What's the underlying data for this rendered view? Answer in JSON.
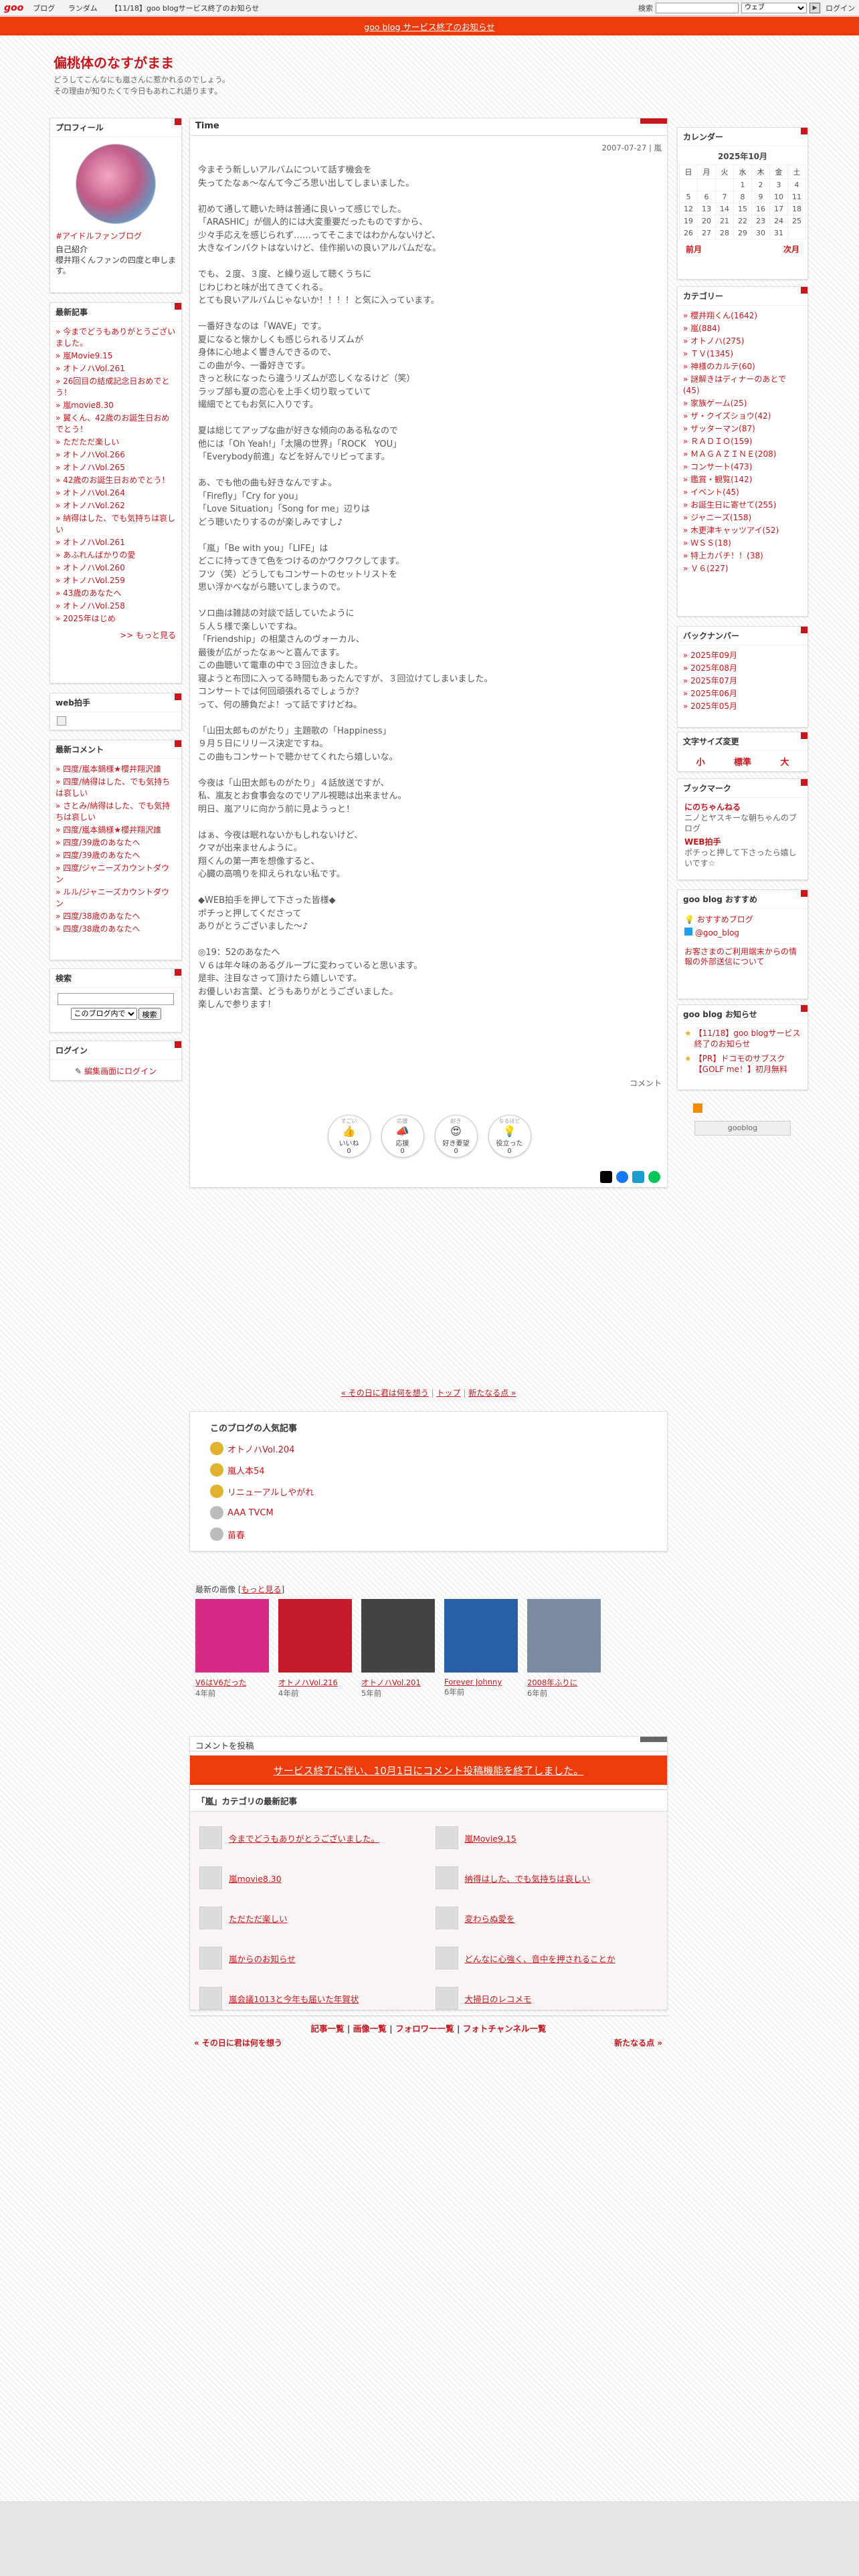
{
  "topbar": {
    "logo": "goo",
    "nav": [
      "ブログ",
      "ランダム",
      "【11/18】goo blogサービス終了のお知らせ"
    ],
    "search_label": "検索",
    "search_select": "ウェブ",
    "login": "ログイン"
  },
  "notice": "goo blog サービス終了のお知らせ",
  "header": {
    "title": "偏桃体のなすがまま",
    "desc1": "どうしてこんなにも嵐さんに惹かれるのでしょう。",
    "desc2": "その理由が知りたくて今日もあれこれ語ります。"
  },
  "profile": {
    "head": "プロフィール",
    "tag": "#アイドルファンブログ",
    "intro_head": "自己紹介",
    "intro": "櫻井翔くんファンの四度と申します。"
  },
  "recent": {
    "head": "最新記事",
    "items": [
      "今までどうもありがとうございました。",
      "嵐Movie9.15",
      "オトノハVol.261",
      "26回目の結成記念日おめでとう！",
      "嵐movie8.30",
      "翼くん、42歳のお誕生日おめでとう！",
      "ただただ楽しい",
      "オトノハVol.266",
      "オトノハVol.265",
      "42歳のお誕生日おめでとう！",
      "オトノハVol.264",
      "オトノハVol.262",
      "納得はした、でも気持ちは哀しい",
      "オトノハVol.261",
      "あふれんばかりの愛",
      "オトノハVol.260",
      "オトノハVol.259",
      "43歳のあなたへ",
      "オトノハVol.258",
      "2025年はじめ"
    ],
    "more": ">> もっと見る"
  },
  "webclap": {
    "head": "web拍手"
  },
  "comments": {
    "head": "最新コメント",
    "items": [
      "四度/嵐本鍋様★櫻井翔沢誰",
      "四度/納得はした、でも気持ちは哀しい",
      "さとみ/納得はした、でも気持ちは哀しい",
      "四度/嵐本鍋様★櫻井翔沢誰",
      "四度/39歳のあなたへ",
      "四度/39歳のあなたへ",
      "四度/ジャニーズカウントダウン",
      "ルル/ジャニーズカウントダウン",
      "四度/38歳のあなたへ",
      "四度/38歳のあなたへ"
    ]
  },
  "search": {
    "head": "検索",
    "select": "このブログ内で",
    "btn": "検索"
  },
  "login": {
    "head": "ログイン",
    "link": "編集画面にログイン"
  },
  "entry": {
    "title": "Time",
    "date": "2007-07-27 | 嵐",
    "body": "今まそう新しいアルバムについて話す機会を\n失ってたなぁ〜なんて今ごろ思い出してしまいました。\n\n初めて通して聴いた時は普通に良いって感じでした。\n「ARASHIC」が個人的には大変重要だったものですから、\n少々手応えを感じられず……ってそこまではわかんないけど、\n大きなインパクトはないけど、佳作揃いの良いアルバムだな。\n\nでも、２度、３度、と繰り返して聴くうちに\nじわじわと味が出てきてくれる。\nとても良いアルバムじゃないか！！！！と気に入っています。\n\n一番好きなのは「WAVE」です。\n夏になると懐かしくも感じられるリズムが\n身体に心地よく響きんできるので、\nこの曲が今、一番好きです。\nきっと秋になったら違うリズムが恋しくなるけど（笑）\nラップ部も夏の恋心を上手く切り取っていて\n繊細でとてもお気に入りです。\n\n夏は総じてアップな曲が好きな傾向のある私なので\n他には「Oh Yeah!」「太陽の世界」「ROCK　YOU」\n「Everybody前進」などを好んでリピってます。\n\nあ、でも他の曲も好きなんですよ。\n「Firefly」「Cry for you」\n「Love Situation」「Song for me」辺りは\nどう聴いたりするのが楽しみですし♪\n\n「嵐」「Be with you」「LIFE」は\nどこに持ってきて色をつけるのかワクワクしてます。\nフツ（笑）どうしてもコンサートのセットリストを\n思い浮かべながら聴いてしまうので。\n\nソロ曲は雑誌の対談で話していたように\n５人５様で楽しいですね。\n「Friendship」の相葉さんのヴォーカル、\n最後が広がったなぁ〜と喜んでます。\nこの曲聴いて電車の中で３回泣きました。\n寝ようと布団に入ってる時間もあったんですが、３回泣けてしまいました。\nコンサートでは何回頑張れるでしょうか？\nって、何の勝負だよ！って話ですけどね。\n\n「山田太郎ものがたり」主題歌の「Happiness」\n９月５日にリリース決定ですね。\nこの曲もコンサートで聴かせてくれたら嬉しいな。\n\n今夜は「山田太郎ものがたり」４話放送ですが、\n私、嵐友とお食事会なのでリアル視聴は出来ません。\n明日、嵐アリに向かう前に見ようっと！\n\nはぁ、今夜は眠れないかもしれないけど、\nクマが出来ませんように。\n翔くんの第一声を想像すると、\n心臓の高鳴りを抑えられない私です。\n\n◆WEB拍手を押して下さった皆様◆\nポチっと押してくださって\nありがとうございました〜♪\n\n◎19：52のあなたへ\nＶ６は年々味のあるグループに変わっていると思います。\n是非、注目なさって頂けたら嬉しいです。\nお優しいお言葉、どうもありがとうございました。\n楽しんで参ります！",
    "comment_link": "コメント"
  },
  "reactions": [
    {
      "top": "すごい",
      "emoji": "👍",
      "label": "いいね",
      "count": "0"
    },
    {
      "top": "応援",
      "emoji": "📣",
      "label": "応援",
      "count": "0"
    },
    {
      "top": "好き",
      "emoji": "😍",
      "label": "好き要望",
      "count": "0"
    },
    {
      "top": "なるほど",
      "emoji": "💡",
      "label": "役立った",
      "count": "0"
    }
  ],
  "bottom": {
    "nav_prev": "« その日に君は何を想う",
    "nav_top": "トップ",
    "nav_next": "新たなる点 »",
    "popular_head": "このブログの人気記事",
    "popular": [
      "オトノハVol.204",
      "嵐人本54",
      "リニューアルしやがれ",
      "AAA TVCM",
      "苗春"
    ],
    "images_head": "最新の画像",
    "images_more": "もっと見る",
    "images": [
      {
        "cap": "V6はV6だった",
        "age": "4年前",
        "color": "#d72a86"
      },
      {
        "cap": "オトノハVol.216",
        "age": "4年前",
        "color": "#c51a2a"
      },
      {
        "cap": "オトノハVol.201",
        "age": "5年前",
        "color": "#444"
      },
      {
        "cap": "Forever Johnny",
        "age": "6年前",
        "color": "#2a5ea8"
      },
      {
        "cap": "2008年ふりに",
        "age": "6年前",
        "color": "#7a8aa0"
      }
    ],
    "comment_post": "コメントを投稿",
    "comment_end": "サービス終了に伴い、10月1日にコメント投稿機能を終了しました。",
    "cat_head": "「嵐」カテゴリの最新記事",
    "cat_items": [
      "今までどうもありがとうございました。",
      "嵐Movie9.15",
      "嵐movie8.30",
      "納得はした、でも気持ちは哀しい",
      "ただただ楽しい",
      "変わらぬ愛を",
      "嵐からのお知らせ",
      "どんなに心強く、音中を押されることか",
      "嵐会議1013と今年も届いた年賀状",
      "大掃日のレコメモ"
    ],
    "footer_links": [
      "記事一覧",
      "画像一覧",
      "フォロワー一覧",
      "フォトチャンネル一覧"
    ],
    "footer_prev": "« その日に君は何を想う",
    "footer_next": "新たなる点 »"
  },
  "calendar": {
    "head": "カレンダー",
    "month": "2025年10月",
    "dow": [
      "日",
      "月",
      "火",
      "水",
      "木",
      "金",
      "土"
    ],
    "weeks": [
      [
        "",
        "",
        "",
        "1",
        "2",
        "3",
        "4"
      ],
      [
        "5",
        "6",
        "7",
        "8",
        "9",
        "10",
        "11"
      ],
      [
        "12",
        "13",
        "14",
        "15",
        "16",
        "17",
        "18"
      ],
      [
        "19",
        "20",
        "21",
        "22",
        "23",
        "24",
        "25"
      ],
      [
        "26",
        "27",
        "28",
        "29",
        "30",
        "31",
        ""
      ]
    ],
    "prev": "前月",
    "next": "次月"
  },
  "categories": {
    "head": "カテゴリー",
    "items": [
      "櫻井翔くん(1642)",
      "嵐(884)",
      "オトノハ(275)",
      "ＴＶ(1345)",
      "神様のカルテ(60)",
      "謎解きはディナーのあとで(45)",
      "家族ゲーム(25)",
      "ザ・クイズショウ(42)",
      "ザッターマン(87)",
      "ＲＡＤＩＯ(159)",
      "ＭＡＧＡＺＩＮＥ(208)",
      "コンサート(473)",
      "鑑賞・観覧(142)",
      "イベント(45)",
      "お誕生日に寄せて(255)",
      "ジャニーズ(158)",
      "木更津キャッツアイ(52)",
      "ＷＳＳ(18)",
      "特上カバチ！！(38)",
      "Ｖ６(227)"
    ]
  },
  "backnumber": {
    "head": "バックナンバー",
    "items": [
      "2025年09月",
      "2025年08月",
      "2025年07月",
      "2025年06月",
      "2025年05月"
    ]
  },
  "fontsize": {
    "head": "文字サイズ変更",
    "small": "小",
    "mid": "標準",
    "large": "大"
  },
  "bookmark": {
    "head": "ブックマーク",
    "items": [
      {
        "name": "にのちゃんねる",
        "desc": "ニノとヤスキーな朝ちゃんのブログ"
      },
      {
        "name": "WEB拍手",
        "desc": "ポチっと押して下さったら嬉しいです☆"
      }
    ]
  },
  "osusume": {
    "head": "goo blog おすすめ",
    "items": [
      "おすすめブログ",
      "@goo_blog"
    ],
    "note": "お客さまのご利用端末からの情報の外部送信について"
  },
  "oshirase": {
    "head": "goo blog お知らせ",
    "items": [
      "【11/18】goo blogサービス終了のお知らせ",
      "【PR】ドコモのサブスク【GOLF me！】初月無料"
    ],
    "badge": "gooblog"
  }
}
